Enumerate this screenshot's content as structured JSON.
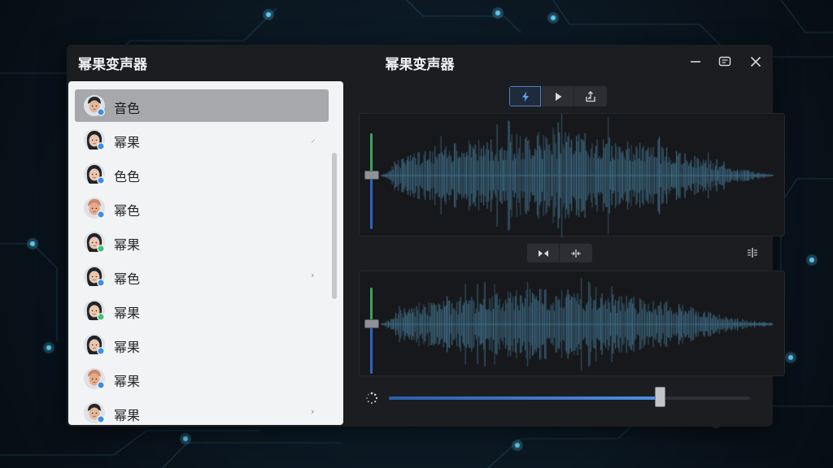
{
  "app": {
    "name": "幂果变声器",
    "window_title": "幂果变声器",
    "accent": "#4a8fe4"
  },
  "window_controls": [
    "minimize-icon",
    "feedback-icon",
    "close-icon"
  ],
  "voices": [
    {
      "label": "音色",
      "avatar": "boy-avatar",
      "selected": true,
      "mark": ""
    },
    {
      "label": "幂果",
      "avatar": "girl-avatar",
      "selected": false,
      "mark": "⸝"
    },
    {
      "label": "色色",
      "avatar": "girl-avatar",
      "selected": false,
      "mark": ""
    },
    {
      "label": "幂色",
      "avatar": "baby-avatar",
      "selected": false,
      "mark": ""
    },
    {
      "label": "幂果",
      "avatar": "girl-avatar-green",
      "selected": false,
      "mark": ""
    },
    {
      "label": "幂色",
      "avatar": "girl-avatar",
      "selected": false,
      "mark": "›"
    },
    {
      "label": "幂果",
      "avatar": "girl-avatar-green",
      "selected": false,
      "mark": ""
    },
    {
      "label": "幂果",
      "avatar": "girl-avatar",
      "selected": false,
      "mark": ""
    },
    {
      "label": "幂果",
      "avatar": "baby-avatar",
      "selected": false,
      "mark": ""
    },
    {
      "label": "幂果",
      "avatar": "boy-avatar",
      "selected": false,
      "mark": "›"
    }
  ],
  "top_controls": [
    {
      "icon": "lightning-icon",
      "active": true
    },
    {
      "icon": "play-icon",
      "active": false
    },
    {
      "icon": "export-icon",
      "active": false
    }
  ],
  "middle_controls": [
    {
      "icon": "mirror-icon"
    },
    {
      "icon": "split-icon"
    }
  ],
  "side_control_icon": "align-icon",
  "bottom_icon": "loading-icon",
  "original_level": 0.5,
  "processed_level": 0.5,
  "progress": 0.75,
  "colors": {
    "wave": "#3f6d86",
    "level_top": "#3aa25a",
    "level_bottom": "#2a66c6"
  }
}
